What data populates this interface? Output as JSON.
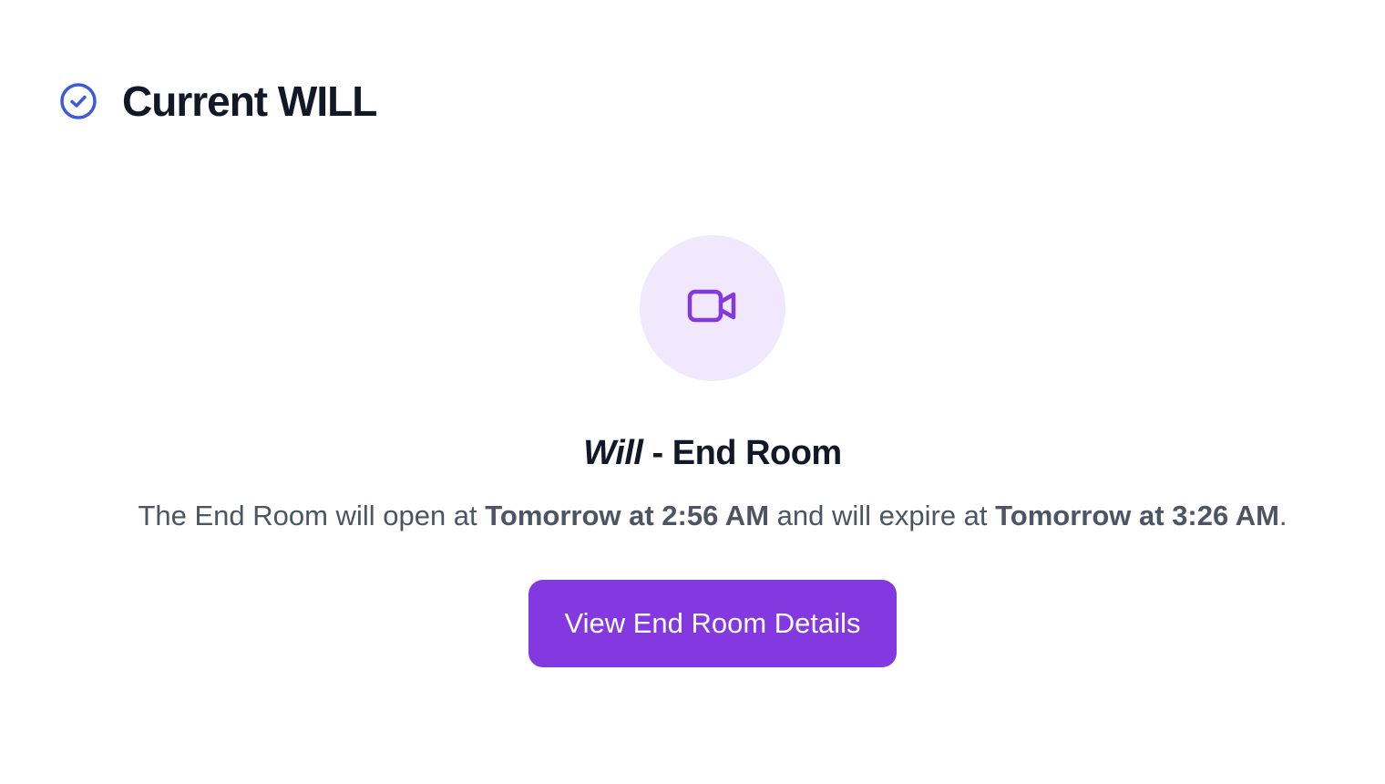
{
  "header": {
    "title": "Current WILL",
    "icon": "check-circle-icon"
  },
  "room": {
    "icon": "video-camera-icon",
    "title_italic": "Will",
    "title_rest": " - End Room",
    "description": {
      "part1": "The End Room will open at ",
      "open_time": "Tomorrow at 2:56 AM",
      "part2": " and will expire at ",
      "expire_time": "Tomorrow at 3:26 AM",
      "part3": "."
    },
    "button_label": "View End Room Details"
  },
  "colors": {
    "accent_blue": "#3b5bdb",
    "brand_purple": "#8338e0",
    "icon_circle_bg": "#f1e8fd",
    "title_text": "#111827",
    "body_text": "#4b5563"
  }
}
